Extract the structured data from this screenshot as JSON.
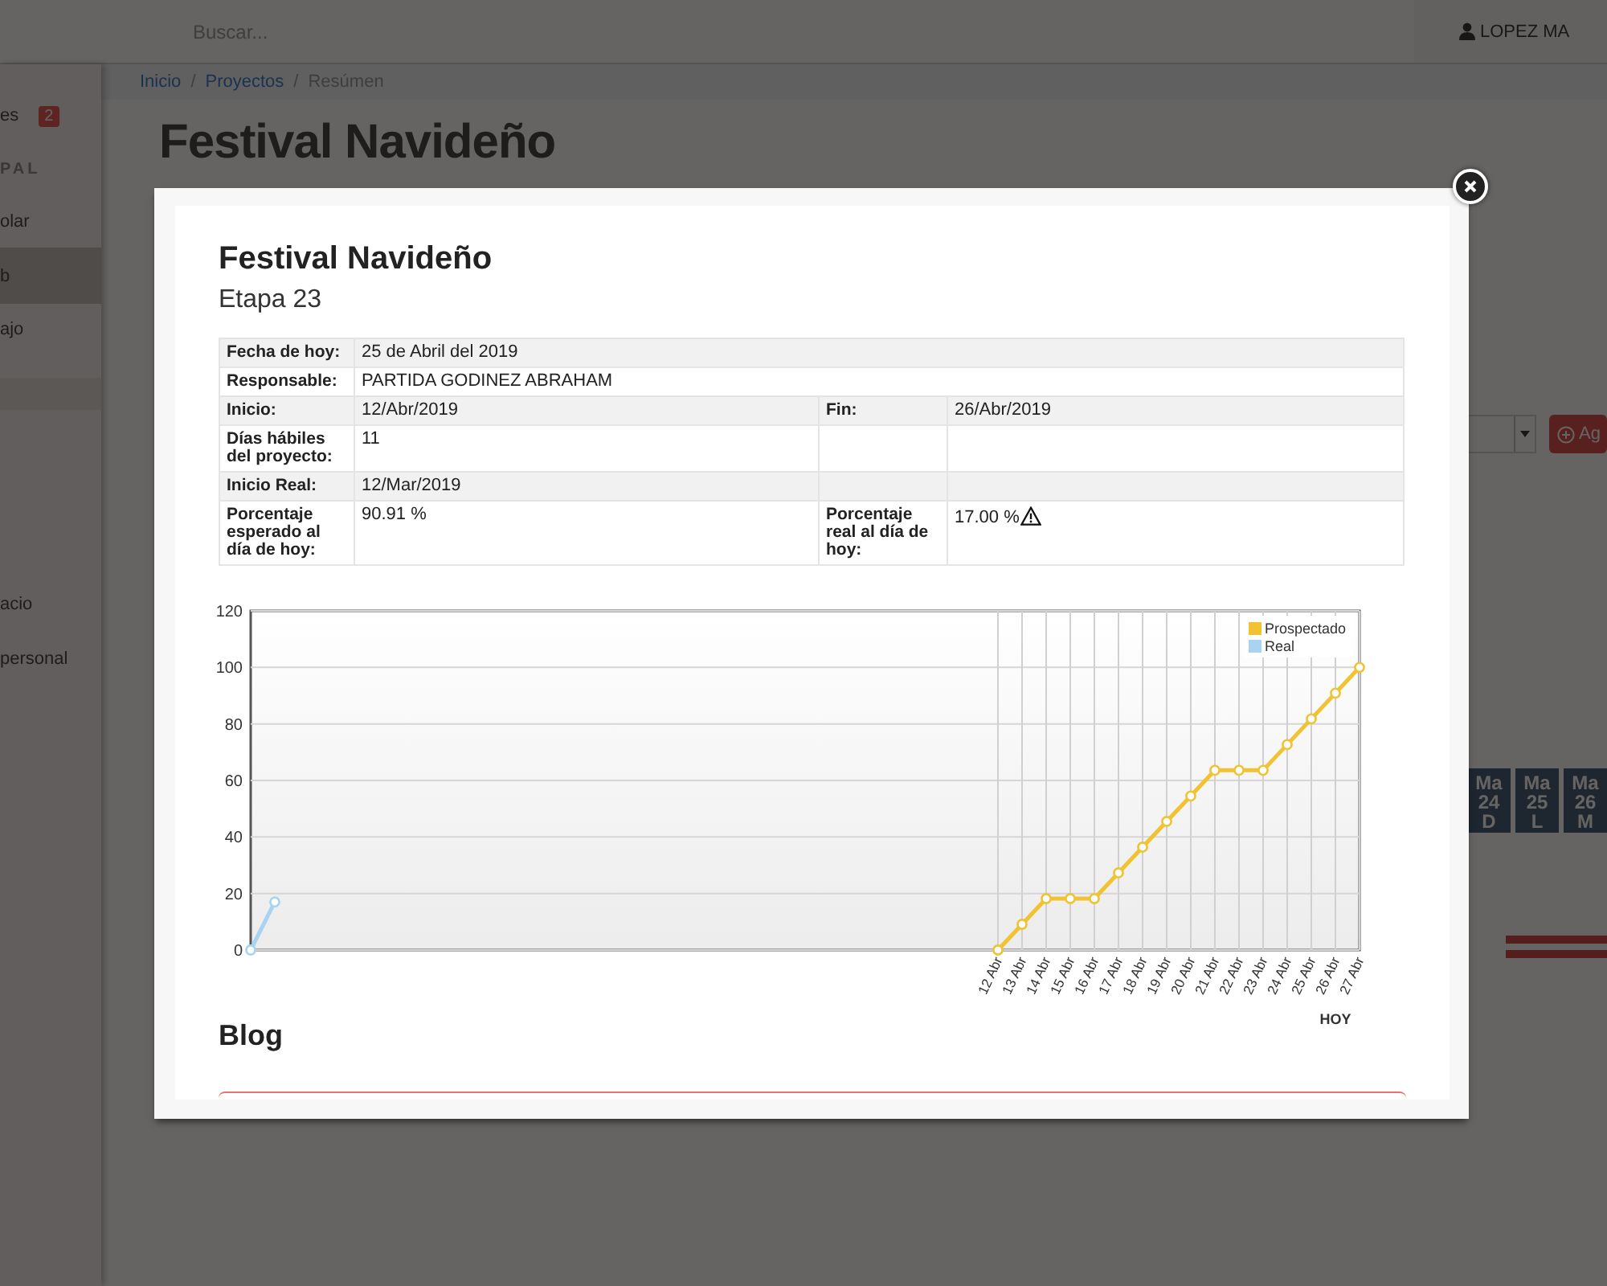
{
  "app": {
    "search": {
      "placeholder": "Buscar..."
    },
    "user": "LOPEZ MA",
    "sidebar": {
      "top_items": [
        {
          "label": "es",
          "kind": "link",
          "badge": "2",
          "selected": false
        },
        {
          "label": "PAL",
          "kind": "heading"
        },
        {
          "label": "olar",
          "kind": "link",
          "selected": false
        },
        {
          "label": "b",
          "kind": "link",
          "selected": true
        },
        {
          "label": "ajo",
          "kind": "link",
          "selected": false
        }
      ],
      "bottom_items": [
        {
          "label": "acio",
          "kind": "link",
          "selected": false
        },
        {
          "label": "personal",
          "kind": "link",
          "selected": false
        }
      ]
    },
    "breadcrumb": [
      {
        "label": "Inicio",
        "kind": "link"
      },
      {
        "label": "Proyectos",
        "kind": "link"
      },
      {
        "label": "Resúmen",
        "kind": "current"
      }
    ],
    "breadcrumb_separator": "/",
    "page_title": "Festival Navideño",
    "add_button": "Ag",
    "gantt_days": [
      {
        "weekday": "Ma",
        "day": "24",
        "letter": "D"
      },
      {
        "weekday": "Ma",
        "day": "25",
        "letter": "L"
      },
      {
        "weekday": "Ma",
        "day": "26",
        "letter": "M"
      }
    ]
  },
  "modal": {
    "title": "Festival Navideño",
    "subtitle": "Etapa 23",
    "rows": [
      {
        "kind": "wide",
        "pairs": [
          {
            "label": "Fecha de hoy:",
            "value": "25 de Abril del 2019",
            "warning": false
          }
        ]
      },
      {
        "kind": "wide",
        "pairs": [
          {
            "label": "Responsable:",
            "value": "PARTIDA GODINEZ ABRAHAM",
            "warning": false
          }
        ]
      },
      {
        "kind": "split",
        "pairs": [
          {
            "label": "Inicio:",
            "value": "12/Abr/2019",
            "warning": false
          },
          {
            "label": "Fin:",
            "value": "26/Abr/2019",
            "warning": false
          }
        ]
      },
      {
        "kind": "split",
        "pairs": [
          {
            "label": "Días hábiles del proyecto:",
            "value": "11",
            "warning": false
          }
        ]
      },
      {
        "kind": "split",
        "pairs": [
          {
            "label": "Inicio Real:",
            "value": "12/Mar/2019",
            "warning": false
          }
        ]
      },
      {
        "kind": "split",
        "pairs": [
          {
            "label": "Porcentaje esperado al día de hoy:",
            "value": "90.91 %",
            "warning": false
          },
          {
            "label": "Porcentaje real al día de hoy:",
            "value": "17.00 %",
            "warning": true
          }
        ]
      }
    ],
    "chart_data": {
      "type": "line",
      "grid": true,
      "legend": true,
      "ylim": [
        0,
        120
      ],
      "yticks": [
        0,
        20,
        40,
        60,
        80,
        100,
        120
      ],
      "categories": [
        null,
        null,
        null,
        null,
        null,
        null,
        null,
        null,
        null,
        null,
        null,
        null,
        null,
        null,
        null,
        null,
        null,
        null,
        null,
        null,
        null,
        null,
        null,
        null,
        null,
        null,
        null,
        null,
        null,
        null,
        null,
        "12 Abr",
        "13 Abr",
        "14 Abr",
        "15 Abr",
        "16 Abr",
        "17 Abr",
        "18 Abr",
        "19 Abr",
        "20 Abr",
        "21 Abr",
        "22 Abr",
        "23 Abr",
        "24 Abr",
        "25 Abr",
        "26 Abr",
        "27 Abr"
      ],
      "series": [
        {
          "name": "Prospectado",
          "color": "#f1c232",
          "marker": "circle",
          "values": [
            null,
            null,
            null,
            null,
            null,
            null,
            null,
            null,
            null,
            null,
            null,
            null,
            null,
            null,
            null,
            null,
            null,
            null,
            null,
            null,
            null,
            null,
            null,
            null,
            null,
            null,
            null,
            null,
            null,
            null,
            null,
            0,
            9.1,
            18.2,
            18.2,
            18.2,
            27.3,
            36.4,
            45.5,
            54.5,
            63.6,
            63.6,
            63.6,
            72.7,
            81.8,
            90.9,
            100
          ]
        },
        {
          "name": "Real",
          "color": "#a8d4f2",
          "marker": "circle",
          "values": [
            0,
            17,
            null,
            null,
            null,
            null,
            null,
            null,
            null,
            null,
            null,
            null,
            null,
            null,
            null,
            null,
            null,
            null,
            null,
            null,
            null,
            null,
            null,
            null,
            null,
            null,
            null,
            null,
            null,
            null,
            null,
            null,
            null,
            null,
            null,
            null,
            null,
            null,
            null,
            null,
            null,
            null,
            null,
            null,
            null,
            null,
            null
          ]
        }
      ],
      "annotations": [
        "HOY"
      ]
    },
    "blog_title": "Blog"
  }
}
